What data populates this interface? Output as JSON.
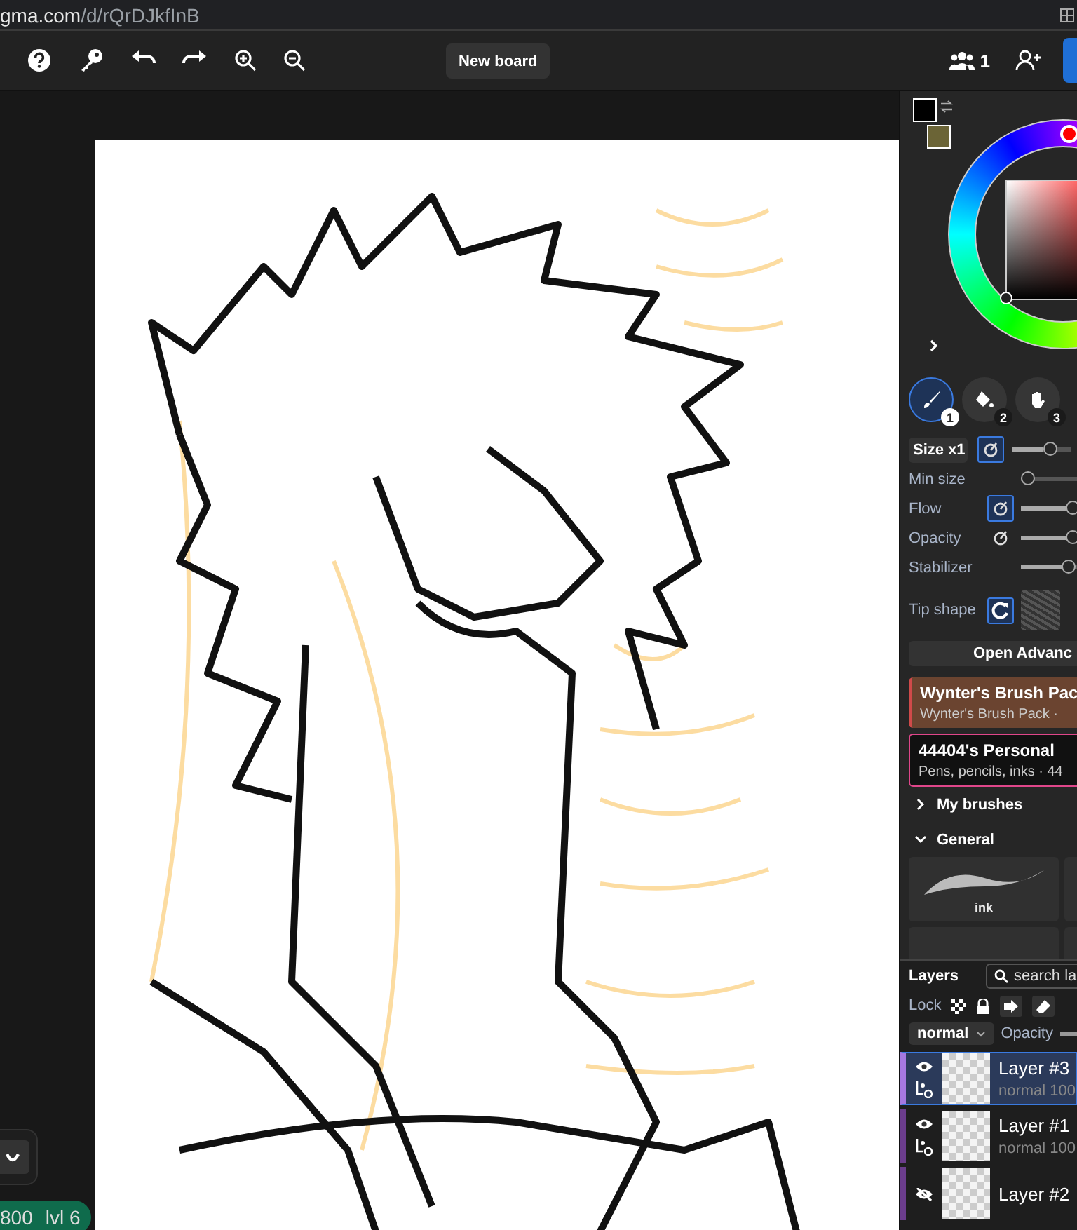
{
  "address_bar": {
    "url_host": "gma.com",
    "url_path": "/d/rQrDJkfInB"
  },
  "toolbar": {
    "board_button": "New board",
    "user_count": "1"
  },
  "corner_status": {
    "score": "800",
    "level_text": "lvl 6"
  },
  "tools": [
    {
      "number": "1",
      "selected": true,
      "kind": "brush"
    },
    {
      "number": "2",
      "selected": false,
      "kind": "fill"
    },
    {
      "number": "3",
      "selected": false,
      "kind": "hand"
    }
  ],
  "brush_settings": [
    {
      "label": "Size x1",
      "kind": "chip",
      "pressure": true,
      "level": 0.7
    },
    {
      "label": "Min size",
      "kind": "plain",
      "level": 0
    },
    {
      "label": "Flow",
      "kind": "plain",
      "pressure": true,
      "level": 1
    },
    {
      "label": "Opacity",
      "kind": "plain",
      "pressure": false,
      "level": 1
    },
    {
      "label": "Stabilizer",
      "kind": "plain",
      "level": 0.9
    }
  ],
  "tip_shape": {
    "label": "Tip shape"
  },
  "advanced_button": "Open Advanc",
  "brush_packs": [
    {
      "title": "Wynter's Brush Pac",
      "subtitle": "Wynter's Brush Pack ·",
      "color": "#6b4430",
      "selected": false
    },
    {
      "title": "44404's Personal",
      "subtitle": "Pens, pencils, inks · 44",
      "color": "#111111",
      "selected": true
    }
  ],
  "brush_groups": [
    {
      "label": "My brushes",
      "expanded": false
    },
    {
      "label": "General",
      "expanded": true
    }
  ],
  "brushes": [
    {
      "name": "ink"
    }
  ],
  "layers_panel": {
    "title": "Layers",
    "search_placeholder": "search la",
    "lock_label": "Lock",
    "blend_mode": "normal",
    "opacity": {
      "label": "Opacity",
      "level": 1
    }
  },
  "layers": [
    {
      "name": "Layer #3",
      "info": "normal 100",
      "visible": true,
      "selected": true
    },
    {
      "name": "Layer #1",
      "info": "normal 100",
      "visible": true,
      "selected": false
    },
    {
      "name": "Layer #2",
      "visible": false,
      "selected": false
    }
  ]
}
